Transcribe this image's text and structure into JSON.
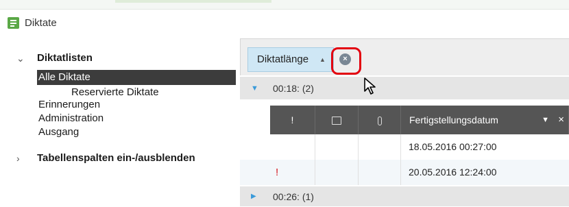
{
  "window": {
    "title": "Diktate",
    "app_icon": "dictation-document-icon",
    "accent": "#5aa846"
  },
  "sidebar": {
    "groups": [
      {
        "label": "Diktatlisten",
        "expanded": true,
        "chevron": "chevron-down-icon"
      },
      {
        "label": "Tabellenspalten ein-/ausblenden",
        "expanded": false,
        "chevron": "chevron-right-icon"
      }
    ],
    "items": [
      {
        "label": "Alle Diktate",
        "selected": true
      },
      {
        "label": "Reservierte Diktate"
      },
      {
        "label": "Erinnerungen"
      },
      {
        "label": "Administration"
      },
      {
        "label": "Ausgang"
      }
    ]
  },
  "grouping": {
    "chip_label": "Diktatlänge",
    "sort_icon": "sort-ascending-icon",
    "remove_icon": "remove-circle-icon",
    "highlight_color": "#e3000f"
  },
  "groups": [
    {
      "label": "00:18: (2)",
      "expanded": true
    },
    {
      "label": "00:26: (1)",
      "expanded": false
    }
  ],
  "table": {
    "columns": [
      {
        "label": "!",
        "icon": "priority-icon"
      },
      {
        "label": "",
        "icon": "comment-icon"
      },
      {
        "label": "",
        "icon": "attachment-icon"
      },
      {
        "label": "Fertigstellungsdatum",
        "filter_icon": "filter-icon",
        "close_icon": "close-icon"
      }
    ],
    "rows": [
      {
        "priority": "",
        "date": "18.05.2016 00:27:00"
      },
      {
        "priority": "!",
        "date": "20.05.2016 12:24:00"
      }
    ],
    "header_color": "#555555",
    "priority_color": "#d4141c"
  }
}
